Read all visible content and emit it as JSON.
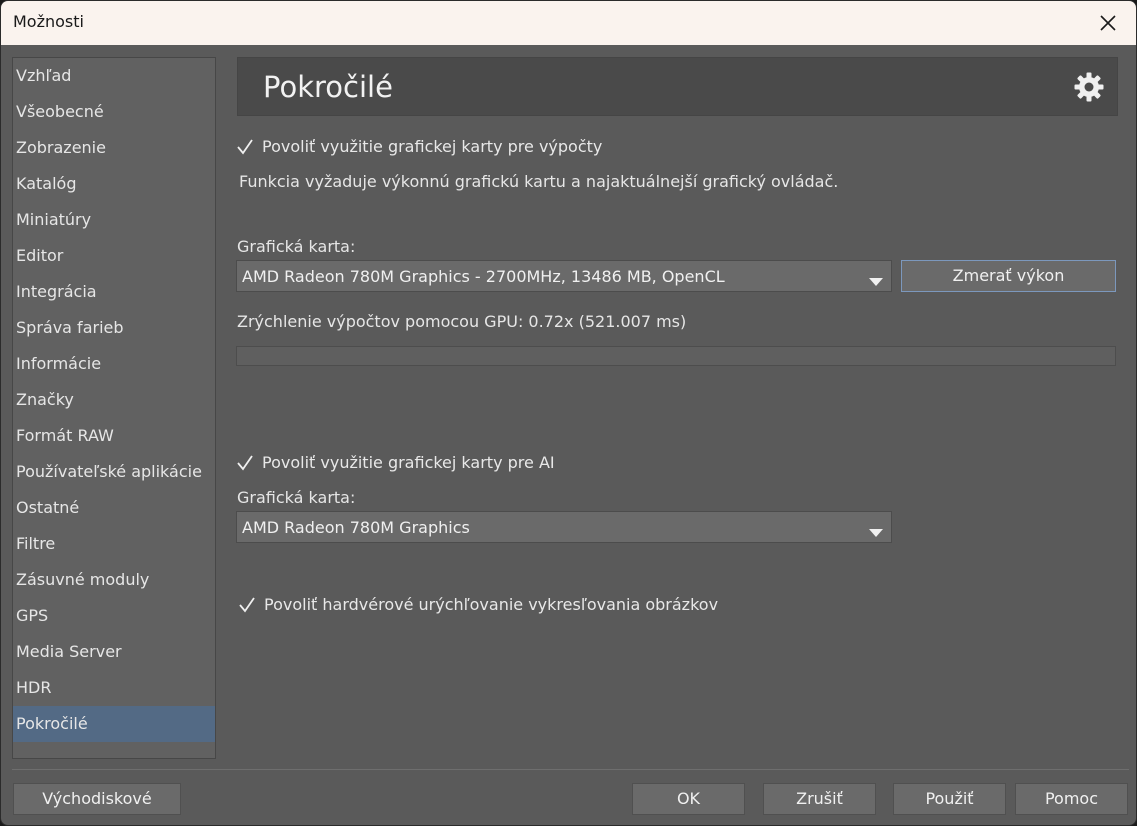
{
  "window": {
    "title": "Možnosti"
  },
  "sidebar": {
    "items": [
      {
        "label": "Vzhľad"
      },
      {
        "label": "Všeobecné"
      },
      {
        "label": "Zobrazenie"
      },
      {
        "label": "Katalóg"
      },
      {
        "label": "Miniatúry"
      },
      {
        "label": "Editor"
      },
      {
        "label": "Integrácia"
      },
      {
        "label": "Správa farieb"
      },
      {
        "label": "Informácie"
      },
      {
        "label": "Značky"
      },
      {
        "label": "Formát RAW"
      },
      {
        "label": "Používateľské aplikácie"
      },
      {
        "label": "Ostatné"
      },
      {
        "label": "Filtre"
      },
      {
        "label": "Zásuvné moduly"
      },
      {
        "label": "GPS"
      },
      {
        "label": "Media Server"
      },
      {
        "label": "HDR"
      },
      {
        "label": "Pokročilé"
      }
    ],
    "selected": "Pokročilé"
  },
  "header": {
    "title": "Pokročilé",
    "icon": "gear-icon"
  },
  "gpu_compute": {
    "checkbox_label": "Povoliť využitie grafickej karty pre výpočty",
    "checked": true,
    "note": "Funkcia vyžaduje výkonnú grafickú kartu a najaktuálnejší grafický ovládač.",
    "card_label": "Grafická karta:",
    "card_value": "AMD Radeon 780M Graphics - 2700MHz, 13486 MB, OpenCL",
    "benchmark_button": "Zmerať výkon",
    "result_text": "Zrýchlenie výpočtov pomocou GPU: 0.72x (521.007 ms)",
    "progress_fraction": 0
  },
  "gpu_ai": {
    "checkbox_label": "Povoliť využitie grafickej karty pre AI",
    "checked": true,
    "card_label": "Grafická karta:",
    "card_value": "AMD Radeon 780M Graphics"
  },
  "hw_render": {
    "checkbox_label": "Povoliť hardvérové urýchľovanie vykresľovania obrázkov",
    "checked": true
  },
  "footer": {
    "defaults": "Východiskové",
    "ok": "OK",
    "cancel": "Zrušiť",
    "apply": "Použiť",
    "help": "Pomoc"
  },
  "colors": {
    "accent": "#536a85",
    "focus_border": "#7c98bd",
    "background": "#5a5a5a"
  }
}
